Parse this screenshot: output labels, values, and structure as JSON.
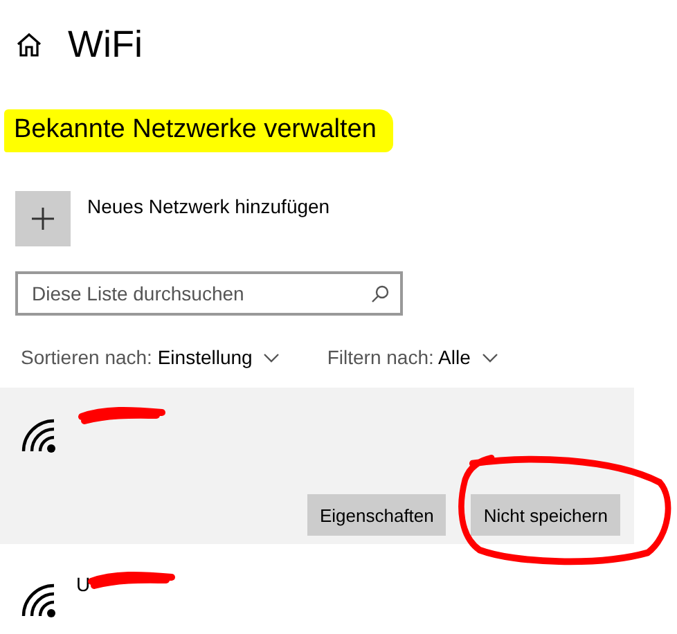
{
  "page": {
    "title": "WiFi"
  },
  "section": {
    "heading": "Bekannte Netzwerke verwalten",
    "highlighted": true
  },
  "add_network": {
    "label": "Neues Netzwerk hinzufügen"
  },
  "search": {
    "placeholder": "Diese Liste durchsuchen"
  },
  "sort": {
    "label": "Sortieren nach:",
    "value": "Einstellung"
  },
  "filter": {
    "label": "Filtern nach:",
    "value": "Alle"
  },
  "networks": [
    {
      "selected": true,
      "redacted": true,
      "buttons": [
        {
          "label": "Eigenschaften",
          "circled": false
        },
        {
          "label": "Nicht speichern",
          "circled": true
        }
      ]
    },
    {
      "name": "U",
      "selected": false,
      "redacted": true
    }
  ]
}
